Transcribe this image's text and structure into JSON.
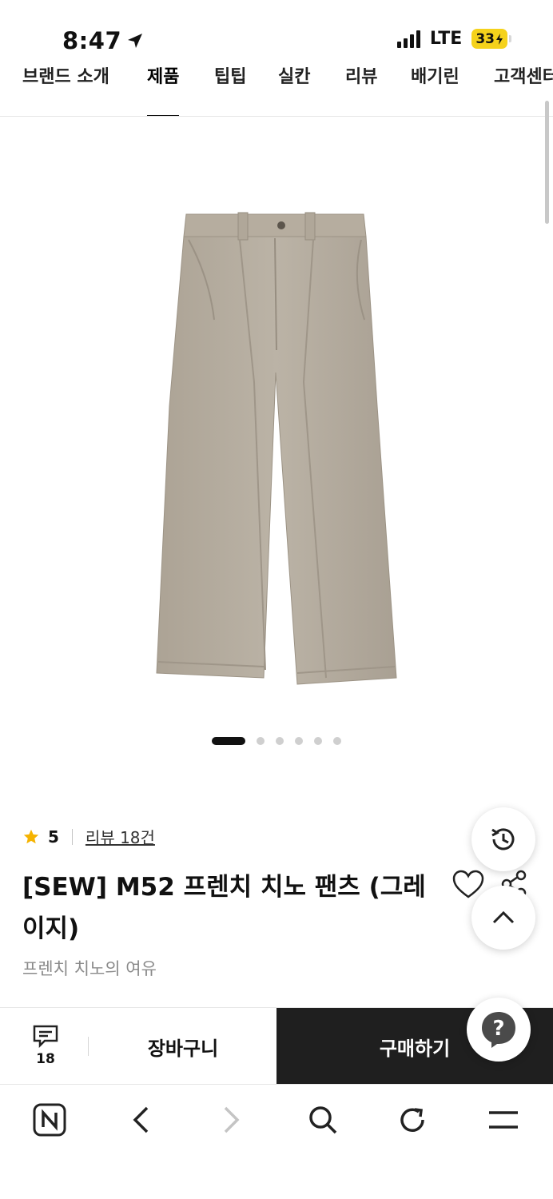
{
  "status_bar": {
    "time": "8:47",
    "network": "LTE",
    "battery": "33"
  },
  "tabs": [
    {
      "label": "브랜드 소개",
      "active": false
    },
    {
      "label": "제품",
      "active": true
    },
    {
      "label": "팁팁",
      "active": false
    },
    {
      "label": "실칸",
      "active": false
    },
    {
      "label": "리뷰",
      "active": false
    },
    {
      "label": "배기린",
      "active": false
    },
    {
      "label": "고객센터",
      "active": false
    }
  ],
  "carousel": {
    "total": 6,
    "current": 1
  },
  "product": {
    "rating": "5",
    "review_link": "리뷰 18건",
    "title": "[SEW] M52 프렌치 치노 팬츠 (그레이지)",
    "subtitle": "프렌치 치노의 여유"
  },
  "buy_bar": {
    "talk_count": "18",
    "cart_label": "장바구니",
    "buy_label": "구매하기"
  },
  "icons": {
    "star": "star-icon",
    "heart": "heart-icon",
    "share": "share-icon",
    "history": "history-icon",
    "scroll_top": "chevron-up-icon",
    "talk": "chat-icon",
    "help": "help-icon",
    "naver": "naver-home-icon",
    "back": "chevron-left-icon",
    "forward": "chevron-right-icon",
    "search": "search-icon",
    "refresh": "refresh-icon",
    "menu": "menu-icon"
  },
  "colors": {
    "star": "#f5b301",
    "buy_button": "#1f1f1f",
    "battery": "#f5d21b",
    "pants": "#b8afa2"
  }
}
